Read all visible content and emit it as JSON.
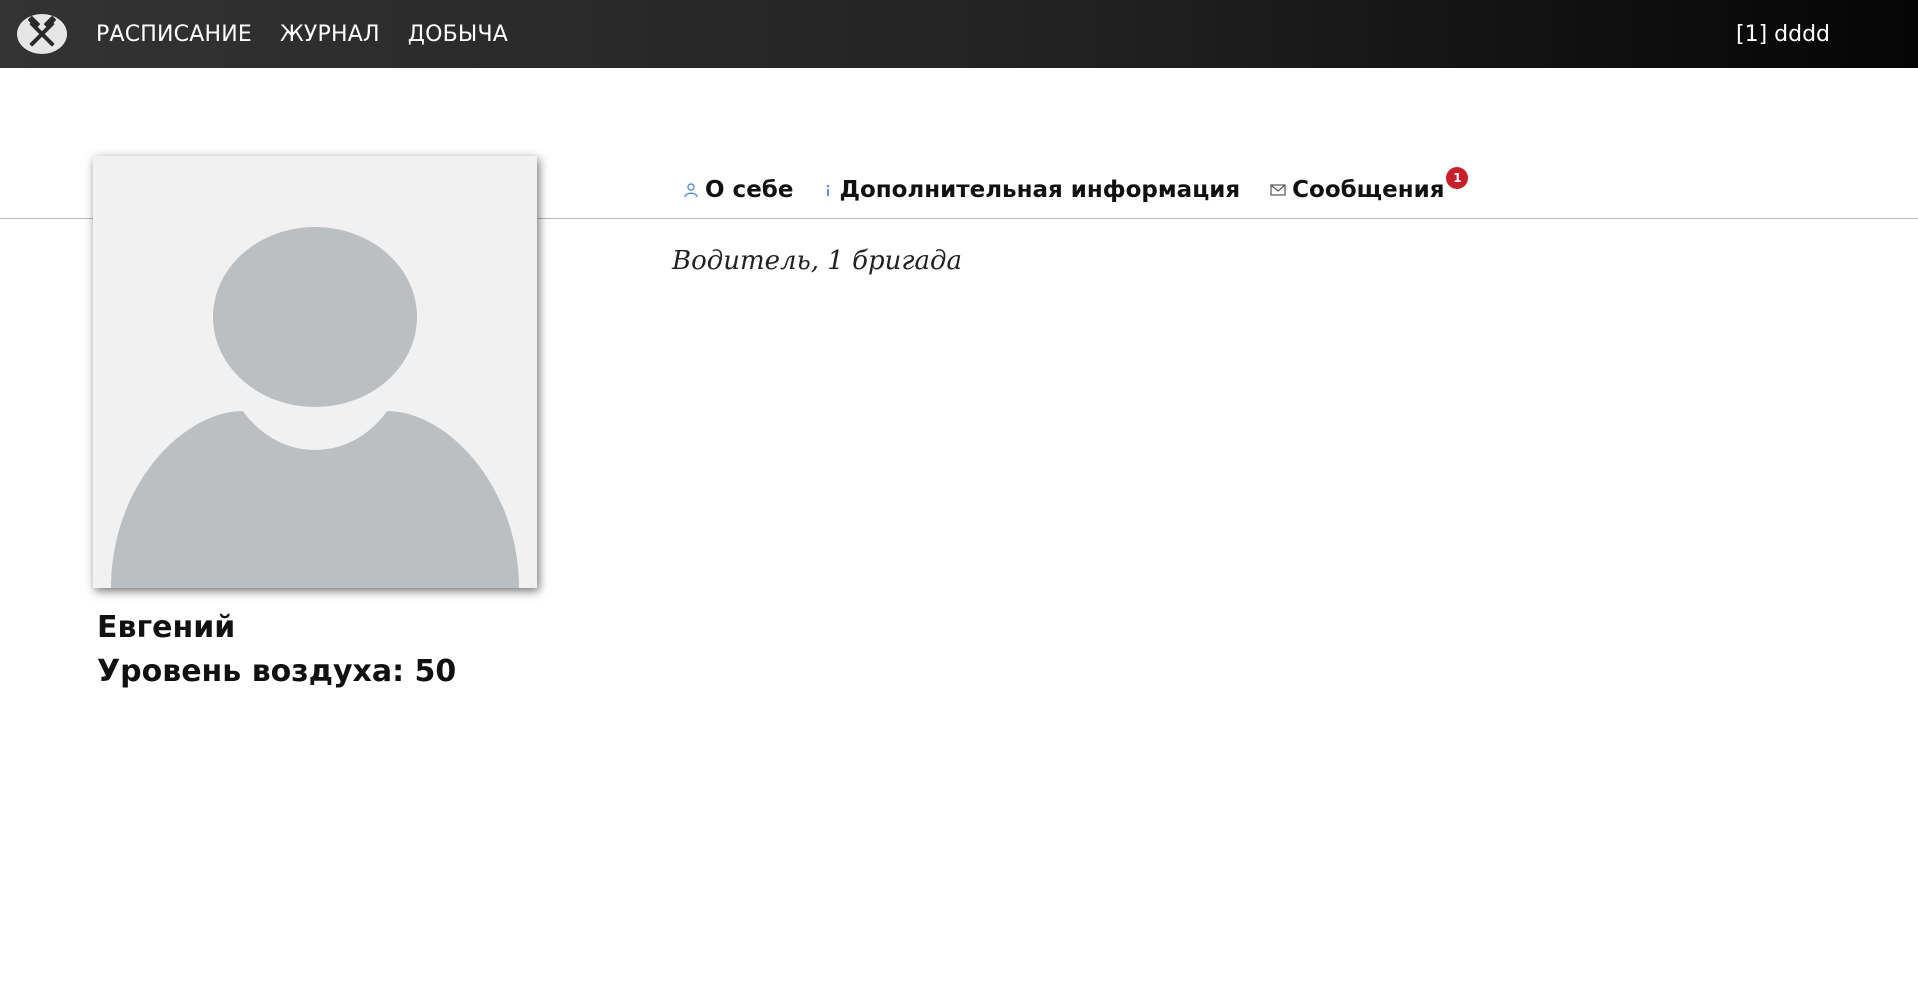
{
  "navbar": {
    "logo_icon": "crossed-hammers-icon",
    "links": [
      {
        "label": "РАСПИСАНИЕ"
      },
      {
        "label": "ЖУРНАЛ"
      },
      {
        "label": "ДОБЫЧА"
      }
    ],
    "user_label": "[1] dddd"
  },
  "profile": {
    "avatar_icon": "default-user-avatar-icon",
    "name": "Евгений",
    "air_level": "Уровень воздуха: 50"
  },
  "tabs": [
    {
      "label": "О себе",
      "icon": "user-icon"
    },
    {
      "label": "Дополнительная информация",
      "icon": "info-icon"
    },
    {
      "label": "Сообщения",
      "icon": "envelope-icon",
      "badge": "1"
    }
  ],
  "content": {
    "description": "Водитель, 1 бригада"
  },
  "colors": {
    "navbar_dark": "#222222",
    "badge_red": "#c8202a",
    "user_icon_blue": "#5b8fd6",
    "avatar_placeholder": "#bcbfc2"
  }
}
